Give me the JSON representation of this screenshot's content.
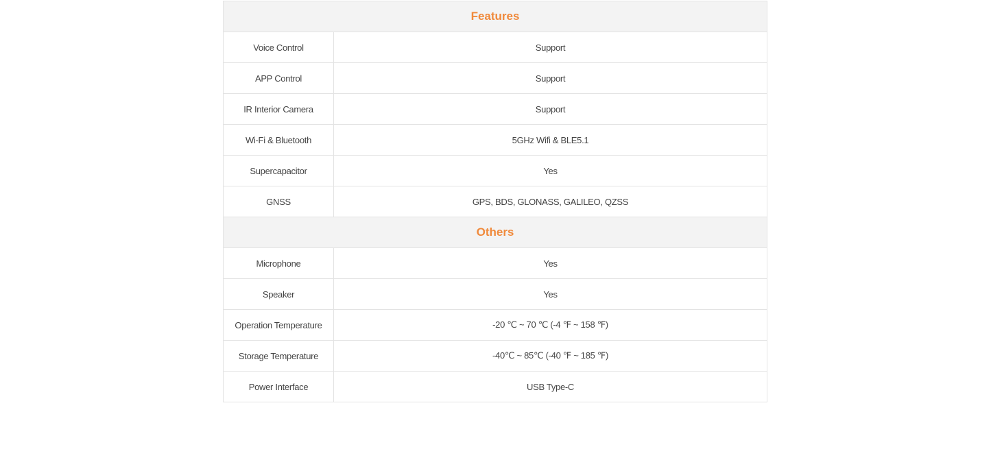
{
  "sections": [
    {
      "title": "Features",
      "rows": [
        {
          "label": "Voice Control",
          "value": "Support"
        },
        {
          "label": "APP Control",
          "value": "Support"
        },
        {
          "label": "IR Interior Camera",
          "value": "Support"
        },
        {
          "label": "Wi-Fi & Bluetooth",
          "value": "5GHz Wifi & BLE5.1"
        },
        {
          "label": "Supercapacitor",
          "value": "Yes"
        },
        {
          "label": "GNSS",
          "value": "GPS, BDS, GLONASS, GALILEO, QZSS"
        }
      ]
    },
    {
      "title": "Others",
      "rows": [
        {
          "label": "Microphone",
          "value": "Yes"
        },
        {
          "label": "Speaker",
          "value": "Yes"
        },
        {
          "label": "Operation Temperature",
          "value": "-20 ℃ ~ 70 ℃ (-4 ℉ ~ 158 ℉)"
        },
        {
          "label": "Storage Temperature",
          "value": "-40℃ ~ 85℃  (-40 ℉ ~ 185 ℉)"
        },
        {
          "label": "Power Interface",
          "value": "USB Type-C"
        }
      ]
    }
  ],
  "colors": {
    "section_title": "#f08a3c",
    "section_background": "#f3f3f3",
    "border": "#e3e3e3",
    "text": "#444444"
  }
}
